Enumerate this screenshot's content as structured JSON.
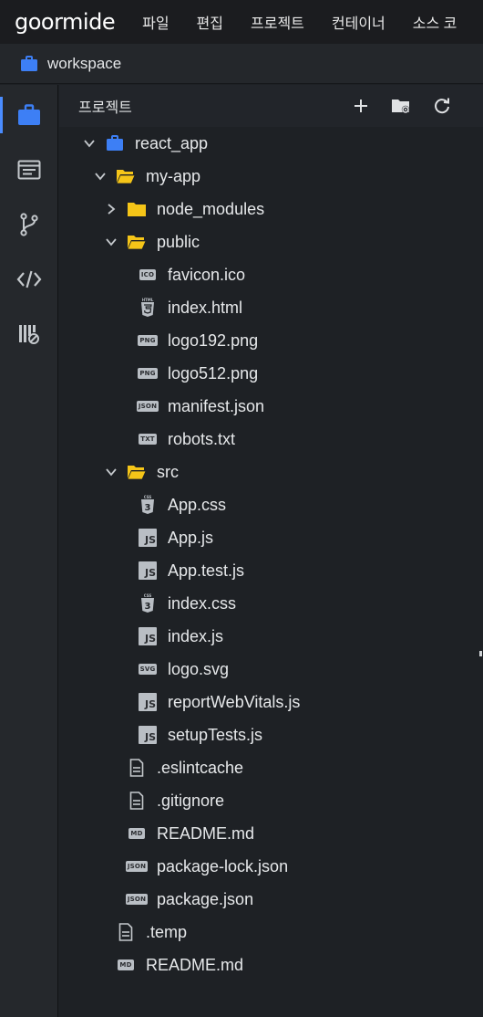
{
  "app": {
    "logo": "goormide",
    "menu": [
      "파일",
      "편집",
      "프로젝트",
      "컨테이너",
      "소스 코"
    ]
  },
  "workspace": {
    "label": "workspace"
  },
  "activity_bar": {
    "items": [
      {
        "name": "project-explorer",
        "icon": "briefcase-icon",
        "active": true
      },
      {
        "name": "terminal",
        "icon": "terminal-window-icon",
        "active": false
      },
      {
        "name": "git",
        "icon": "git-branch-icon",
        "active": false
      },
      {
        "name": "code",
        "icon": "code-brackets-icon",
        "active": false
      },
      {
        "name": "extensions",
        "icon": "extension-icon",
        "active": false
      }
    ]
  },
  "panel": {
    "title": "프로젝트",
    "actions": [
      "plus-icon",
      "folder-settings-icon",
      "refresh-icon"
    ]
  },
  "tree": [
    {
      "label": "react_app",
      "type": "project",
      "depth": 0,
      "expanded": true
    },
    {
      "label": "my-app",
      "type": "folder",
      "depth": 1,
      "expanded": true
    },
    {
      "label": "node_modules",
      "type": "folder",
      "depth": 2,
      "expanded": false
    },
    {
      "label": "public",
      "type": "folder",
      "depth": 2,
      "expanded": true
    },
    {
      "label": "favicon.ico",
      "type": "file",
      "badge": "ICO",
      "depth": 3
    },
    {
      "label": "index.html",
      "type": "file",
      "badge": "HTML5",
      "depth": 3
    },
    {
      "label": "logo192.png",
      "type": "file",
      "badge": "PNG",
      "depth": 3
    },
    {
      "label": "logo512.png",
      "type": "file",
      "badge": "PNG",
      "depth": 3
    },
    {
      "label": "manifest.json",
      "type": "file",
      "badge": "JSON",
      "depth": 3
    },
    {
      "label": "robots.txt",
      "type": "file",
      "badge": "TXT",
      "depth": 3
    },
    {
      "label": "src",
      "type": "folder",
      "depth": 2,
      "expanded": true
    },
    {
      "label": "App.css",
      "type": "file",
      "badge": "CSS3",
      "depth": 3
    },
    {
      "label": "App.js",
      "type": "file",
      "badge": "JS",
      "depth": 3
    },
    {
      "label": "App.test.js",
      "type": "file",
      "badge": "JS",
      "depth": 3
    },
    {
      "label": "index.css",
      "type": "file",
      "badge": "CSS3",
      "depth": 3
    },
    {
      "label": "index.js",
      "type": "file",
      "badge": "JS",
      "depth": 3
    },
    {
      "label": "logo.svg",
      "type": "file",
      "badge": "SVG",
      "depth": 3
    },
    {
      "label": "reportWebVitals.js",
      "type": "file",
      "badge": "JS",
      "depth": 3
    },
    {
      "label": "setupTests.js",
      "type": "file",
      "badge": "JS",
      "depth": 3
    },
    {
      "label": ".eslintcache",
      "type": "file",
      "badge": "DOC",
      "depth": 2
    },
    {
      "label": ".gitignore",
      "type": "file",
      "badge": "DOC",
      "depth": 2
    },
    {
      "label": "README.md",
      "type": "file",
      "badge": "MD",
      "depth": 2
    },
    {
      "label": "package-lock.json",
      "type": "file",
      "badge": "JSON",
      "depth": 2
    },
    {
      "label": "package.json",
      "type": "file",
      "badge": "JSON",
      "depth": 2
    },
    {
      "label": ".temp",
      "type": "file",
      "badge": "DOC",
      "depth": 1
    },
    {
      "label": "README.md",
      "type": "file",
      "badge": "MD",
      "depth": 1
    }
  ],
  "colors": {
    "accent": "#4a8cff",
    "folder": "#f5c518",
    "project": "#3d7ff5",
    "badge": "#b9bec4"
  }
}
